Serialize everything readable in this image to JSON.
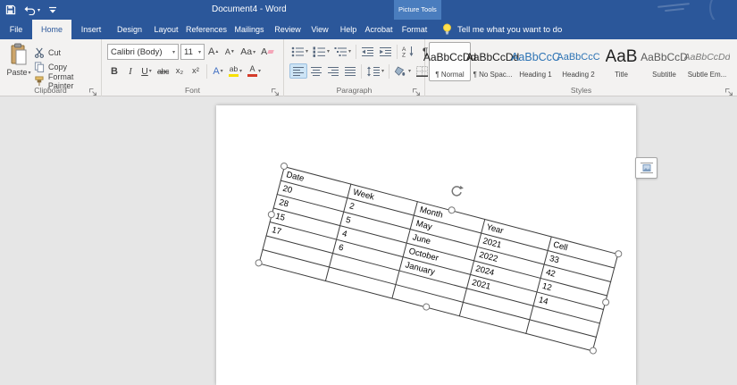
{
  "titlebar": {
    "title": "Document4 - Word",
    "contextual": "Picture Tools"
  },
  "tabs": {
    "items": [
      "File",
      "Home",
      "Insert",
      "Design",
      "Layout",
      "References",
      "Mailings",
      "Review",
      "View",
      "Help",
      "Acrobat"
    ],
    "contextual_tab": "Format",
    "tell_me": "Tell me what you want to do"
  },
  "ribbon": {
    "clipboard": {
      "group_label": "Clipboard",
      "paste": "Paste",
      "cut": "Cut",
      "copy": "Copy",
      "format_painter": "Format Painter"
    },
    "font": {
      "group_label": "Font",
      "font_name": "Calibri (Body)",
      "font_size": "11",
      "bold": "B",
      "italic": "I",
      "underline": "U",
      "strikethrough": "abc",
      "subscript": "x₂",
      "superscript": "x²",
      "grow": "A",
      "shrink": "A",
      "change_case": "Aa",
      "clear_formatting": "A",
      "text_effects": "A",
      "highlight": "ab",
      "font_color": "A"
    },
    "paragraph": {
      "group_label": "Paragraph",
      "sort_a": "A",
      "sort_z": "Z",
      "pilcrow": "¶"
    },
    "styles": {
      "group_label": "Styles",
      "items": [
        {
          "preview": "AaBbCcDd",
          "name": "¶ Normal"
        },
        {
          "preview": "AaBbCcDd",
          "name": "¶ No Spac..."
        },
        {
          "preview": "AaBbCcC",
          "name": "Heading 1"
        },
        {
          "preview": "AaBbCcC",
          "name": "Heading 2"
        },
        {
          "preview": "AaB",
          "name": "Title"
        },
        {
          "preview": "AaBbCcD",
          "name": "Subtitle"
        },
        {
          "preview": "AaBbCcDd",
          "name": "Subtle Em..."
        }
      ]
    }
  },
  "document": {
    "table": {
      "headers": [
        "Date",
        "Week",
        "Month",
        "Year",
        "Cell"
      ],
      "rows": [
        [
          "20",
          "2",
          "May",
          "2021",
          "33"
        ],
        [
          "28",
          "5",
          "June",
          "2022",
          "42"
        ],
        [
          "15",
          "4",
          "October",
          "2024",
          "12"
        ],
        [
          "17",
          "6",
          "January",
          "2021",
          "14"
        ]
      ]
    }
  },
  "colors": {
    "titlebar_blue": "#2b579a",
    "contextual_blue": "#4a7dbe",
    "heading_blue": "#2e74b5",
    "highlight_yellow": "#f7e000",
    "font_color_red": "#d43b2a"
  }
}
